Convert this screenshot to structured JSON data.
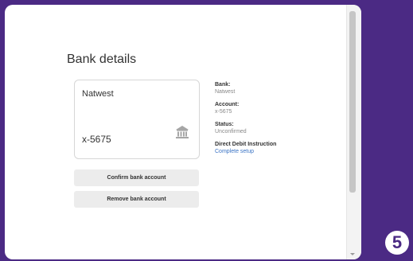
{
  "page": {
    "title": "Bank details"
  },
  "card": {
    "bank_name": "Natwest",
    "account_masked": "x-5675",
    "icon": "bank-building-icon"
  },
  "buttons": {
    "confirm_label": "Confirm bank account",
    "remove_label": "Remove bank account"
  },
  "details": {
    "bank_label": "Bank:",
    "bank_value": "Natwest",
    "account_label": "Account:",
    "account_value": "x-5675",
    "status_label": "Status:",
    "status_value": "Unconfirmed",
    "dd_label": "Direct Debit Instruction",
    "dd_link": "Complete setup"
  },
  "badge": {
    "step_number": "5"
  },
  "colors": {
    "frame_background": "#4b2a84",
    "link": "#3b74c5"
  }
}
